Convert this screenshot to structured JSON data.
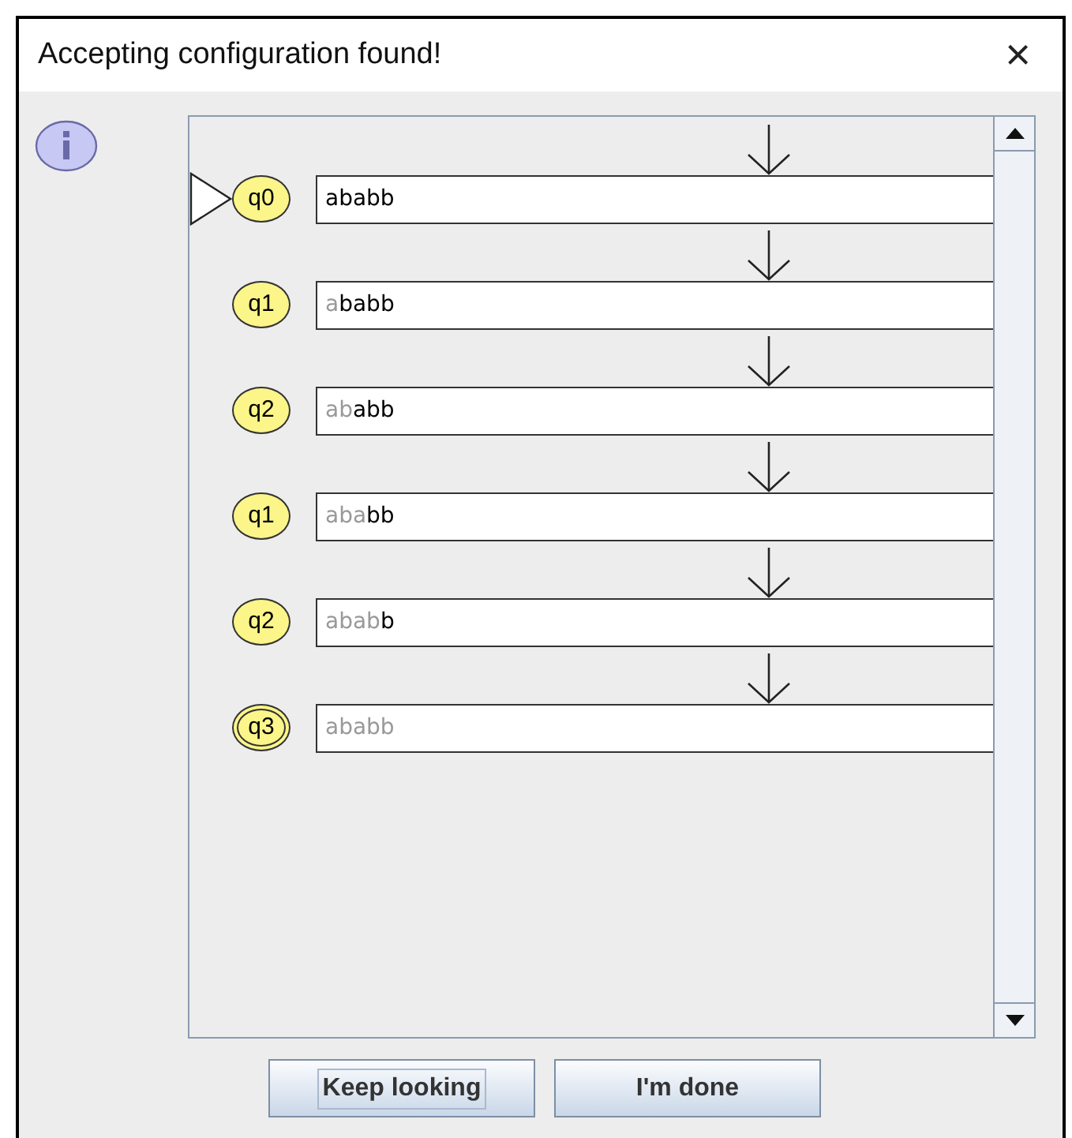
{
  "window": {
    "title": "Accepting configuration found!",
    "close": "×"
  },
  "configurations": [
    {
      "state": "q0",
      "initial": true,
      "final": false,
      "unread": "ababb"
    },
    {
      "state": "q1",
      "initial": false,
      "final": false,
      "read": "a",
      "unread": "babb"
    },
    {
      "state": "q2",
      "initial": false,
      "final": false,
      "read": "ab",
      "unread": "abb"
    },
    {
      "state": "q1",
      "initial": false,
      "final": false,
      "read": "aba",
      "unread": "bb"
    },
    {
      "state": "q2",
      "initial": false,
      "final": false,
      "read": "abab",
      "unread": "b"
    },
    {
      "state": "q3",
      "initial": false,
      "final": true,
      "read": "ababb"
    }
  ],
  "buttons": [
    "Keep looking",
    "I'm done"
  ]
}
